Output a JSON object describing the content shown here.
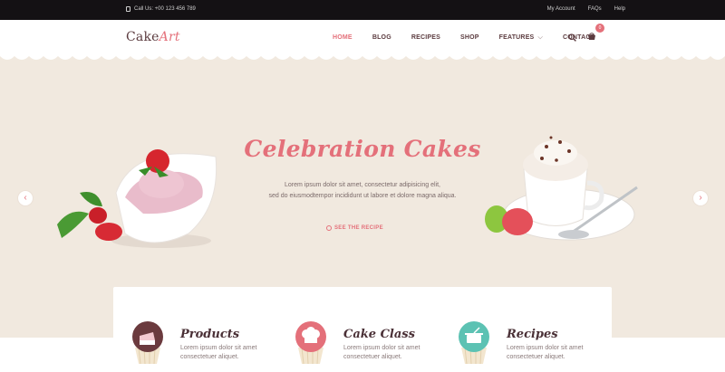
{
  "topbar": {
    "phone": "Call Us: +00 123 456 789",
    "links": [
      "My Account",
      "FAQs",
      "Help"
    ]
  },
  "header": {
    "logo_main": "Cake",
    "logo_accent": "Art",
    "nav": [
      "HOME",
      "BLOG",
      "RECIPES",
      "SHOP",
      "FEATURES",
      "CONTACT"
    ],
    "active_nav": "HOME",
    "cart_count": "0",
    "icons": [
      "search-icon",
      "cart-icon"
    ]
  },
  "hero": {
    "title": "Celebration Cakes",
    "text_line1": "Lorem ipsum dolor sit amet, consectetur adipisicing elit,",
    "text_line2": "sed do eiusmodtempor incididunt ut labore et dolore magna aliqua.",
    "cta": "SEE THE RECIPE",
    "prev_arrow": "‹",
    "next_arrow": "›"
  },
  "features": [
    {
      "title": "Products",
      "line1": "Lorem ipsum dolor sit amet",
      "line2": "consectetuer aliquet.",
      "icon": "cake-slice-icon",
      "color": "#6b3a3e"
    },
    {
      "title": "Cake Class",
      "line1": "Lorem ipsum dolor sit amet",
      "line2": "consectetuer aliquet.",
      "icon": "chef-hat-icon",
      "color": "#e4707a"
    },
    {
      "title": "Recipes",
      "line1": "Lorem ipsum dolor sit amet",
      "line2": "consectetuer aliquet.",
      "icon": "pot-icon",
      "color": "#5cc2b3"
    }
  ],
  "colors": {
    "accent": "#e4707a",
    "dark": "#5b3b3f",
    "topbar": "#141114",
    "hero_bg": "#f1e9df"
  }
}
